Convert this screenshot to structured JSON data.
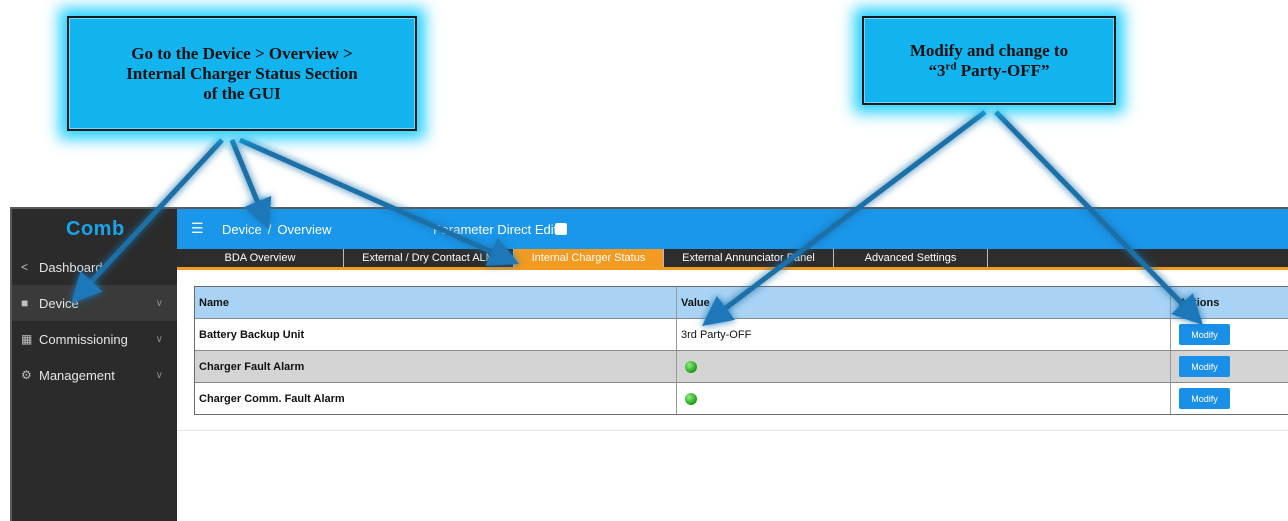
{
  "callouts": {
    "left": {
      "line1": "Go to the Device > Overview >",
      "line2": "Internal Charger Status Section",
      "line3": "of the GUI"
    },
    "right": {
      "line1": "Modify and change to",
      "line2_pre": "“3",
      "line2_sup": "rd",
      "line2_post": " Party-OFF”"
    }
  },
  "app": {
    "logo": "Comb",
    "sidebar": [
      {
        "label": "Dashboard",
        "icon": "share-icon"
      },
      {
        "label": "Device",
        "icon": "monitor-icon"
      },
      {
        "label": "Commissioning",
        "icon": "grid-icon"
      },
      {
        "label": "Management",
        "icon": "gear-icon"
      }
    ],
    "breadcrumb": {
      "section": "Device",
      "sep": "/",
      "page": "Overview"
    },
    "parameter_direct_edit_label": "Parameter Direct Edit",
    "tabs": [
      {
        "label": "BDA Overview"
      },
      {
        "label": "External / Dry Contact ALM"
      },
      {
        "label": "Internal Charger Status"
      },
      {
        "label": "External Annunciator Panel"
      },
      {
        "label": "Advanced Settings"
      }
    ],
    "active_tab": "Internal Charger Status",
    "table": {
      "headers": {
        "name": "Name",
        "value": "Value",
        "actions": "Actions"
      },
      "rows": [
        {
          "name": "Battery Backup Unit",
          "value": "3rd Party-OFF",
          "action": "Modify"
        },
        {
          "name": "Charger Fault Alarm",
          "value_status": "green",
          "action": "Modify"
        },
        {
          "name": "Charger Comm. Fault Alarm",
          "value_status": "green",
          "action": "Modify"
        }
      ]
    }
  },
  "colors": {
    "callout": "#12b4f0",
    "topbar": "#1a96ea",
    "active_tab": "#f39a20",
    "sidebar": "#2b2b2b",
    "table_header": "#a9d3f5",
    "modify_button": "#1a8fe8"
  }
}
